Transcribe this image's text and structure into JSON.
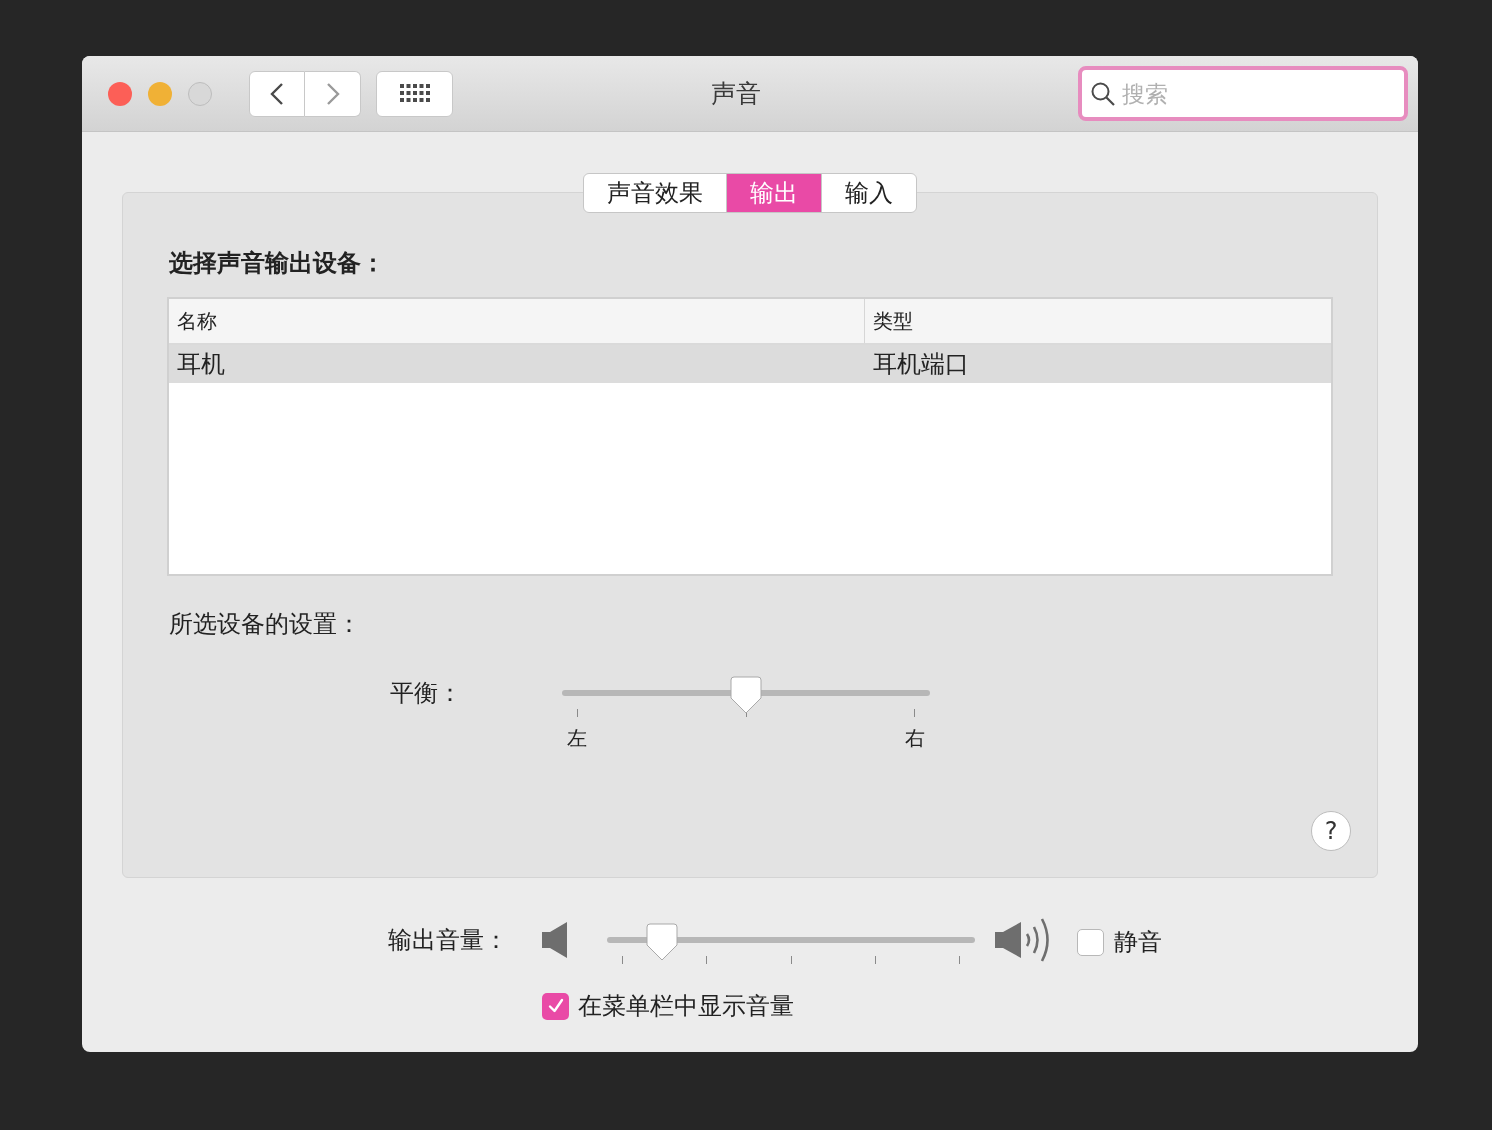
{
  "window": {
    "title": "声音",
    "search": {
      "placeholder": "搜索"
    }
  },
  "tabs": [
    {
      "label": "声音效果",
      "selected": false
    },
    {
      "label": "输出",
      "selected": true
    },
    {
      "label": "输入",
      "selected": false
    }
  ],
  "device_heading": "选择声音输出设备：",
  "table": {
    "columns": [
      "名称",
      "类型"
    ],
    "rows": [
      {
        "cells": [
          "耳机",
          "耳机端口"
        ],
        "selected": true
      }
    ]
  },
  "settings_heading": "所选设备的设置：",
  "balance": {
    "label": "平衡：",
    "level": 0.5,
    "left": "左",
    "right": "右"
  },
  "help": "?",
  "volume": {
    "label": "输出音量：",
    "level": 0.15
  },
  "mute": {
    "label": "静音",
    "checked": false
  },
  "show_in_menu": {
    "label": "在菜单栏中显示音量",
    "checked": true
  }
}
